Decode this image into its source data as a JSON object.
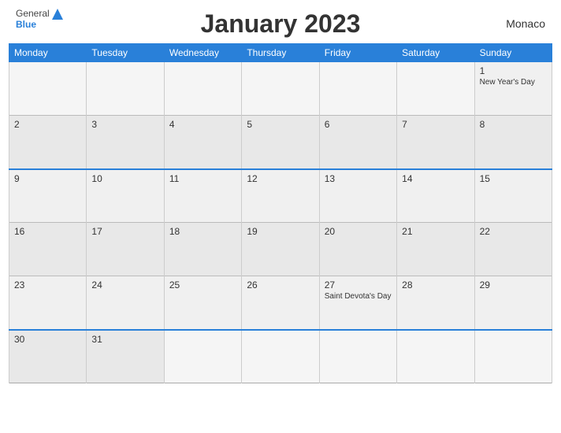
{
  "header": {
    "title": "January 2023",
    "country": "Monaco",
    "logo": {
      "general": "General",
      "blue": "Blue"
    }
  },
  "weekdays": [
    "Monday",
    "Tuesday",
    "Wednesday",
    "Thursday",
    "Friday",
    "Saturday",
    "Sunday"
  ],
  "weeks": [
    {
      "blue_top": false,
      "days": [
        {
          "date": "",
          "event": ""
        },
        {
          "date": "",
          "event": ""
        },
        {
          "date": "",
          "event": ""
        },
        {
          "date": "",
          "event": ""
        },
        {
          "date": "",
          "event": ""
        },
        {
          "date": "",
          "event": ""
        },
        {
          "date": "1",
          "event": "New Year's Day"
        }
      ]
    },
    {
      "blue_top": false,
      "days": [
        {
          "date": "2",
          "event": ""
        },
        {
          "date": "3",
          "event": ""
        },
        {
          "date": "4",
          "event": ""
        },
        {
          "date": "5",
          "event": ""
        },
        {
          "date": "6",
          "event": ""
        },
        {
          "date": "7",
          "event": ""
        },
        {
          "date": "8",
          "event": ""
        }
      ]
    },
    {
      "blue_top": true,
      "days": [
        {
          "date": "9",
          "event": ""
        },
        {
          "date": "10",
          "event": ""
        },
        {
          "date": "11",
          "event": ""
        },
        {
          "date": "12",
          "event": ""
        },
        {
          "date": "13",
          "event": ""
        },
        {
          "date": "14",
          "event": ""
        },
        {
          "date": "15",
          "event": ""
        }
      ]
    },
    {
      "blue_top": false,
      "days": [
        {
          "date": "16",
          "event": ""
        },
        {
          "date": "17",
          "event": ""
        },
        {
          "date": "18",
          "event": ""
        },
        {
          "date": "19",
          "event": ""
        },
        {
          "date": "20",
          "event": ""
        },
        {
          "date": "21",
          "event": ""
        },
        {
          "date": "22",
          "event": ""
        }
      ]
    },
    {
      "blue_top": false,
      "days": [
        {
          "date": "23",
          "event": ""
        },
        {
          "date": "24",
          "event": ""
        },
        {
          "date": "25",
          "event": ""
        },
        {
          "date": "26",
          "event": ""
        },
        {
          "date": "27",
          "event": "Saint Devota's Day"
        },
        {
          "date": "28",
          "event": ""
        },
        {
          "date": "29",
          "event": ""
        }
      ]
    },
    {
      "blue_top": true,
      "days": [
        {
          "date": "30",
          "event": ""
        },
        {
          "date": "31",
          "event": ""
        },
        {
          "date": "",
          "event": ""
        },
        {
          "date": "",
          "event": ""
        },
        {
          "date": "",
          "event": ""
        },
        {
          "date": "",
          "event": ""
        },
        {
          "date": "",
          "event": ""
        }
      ]
    }
  ]
}
